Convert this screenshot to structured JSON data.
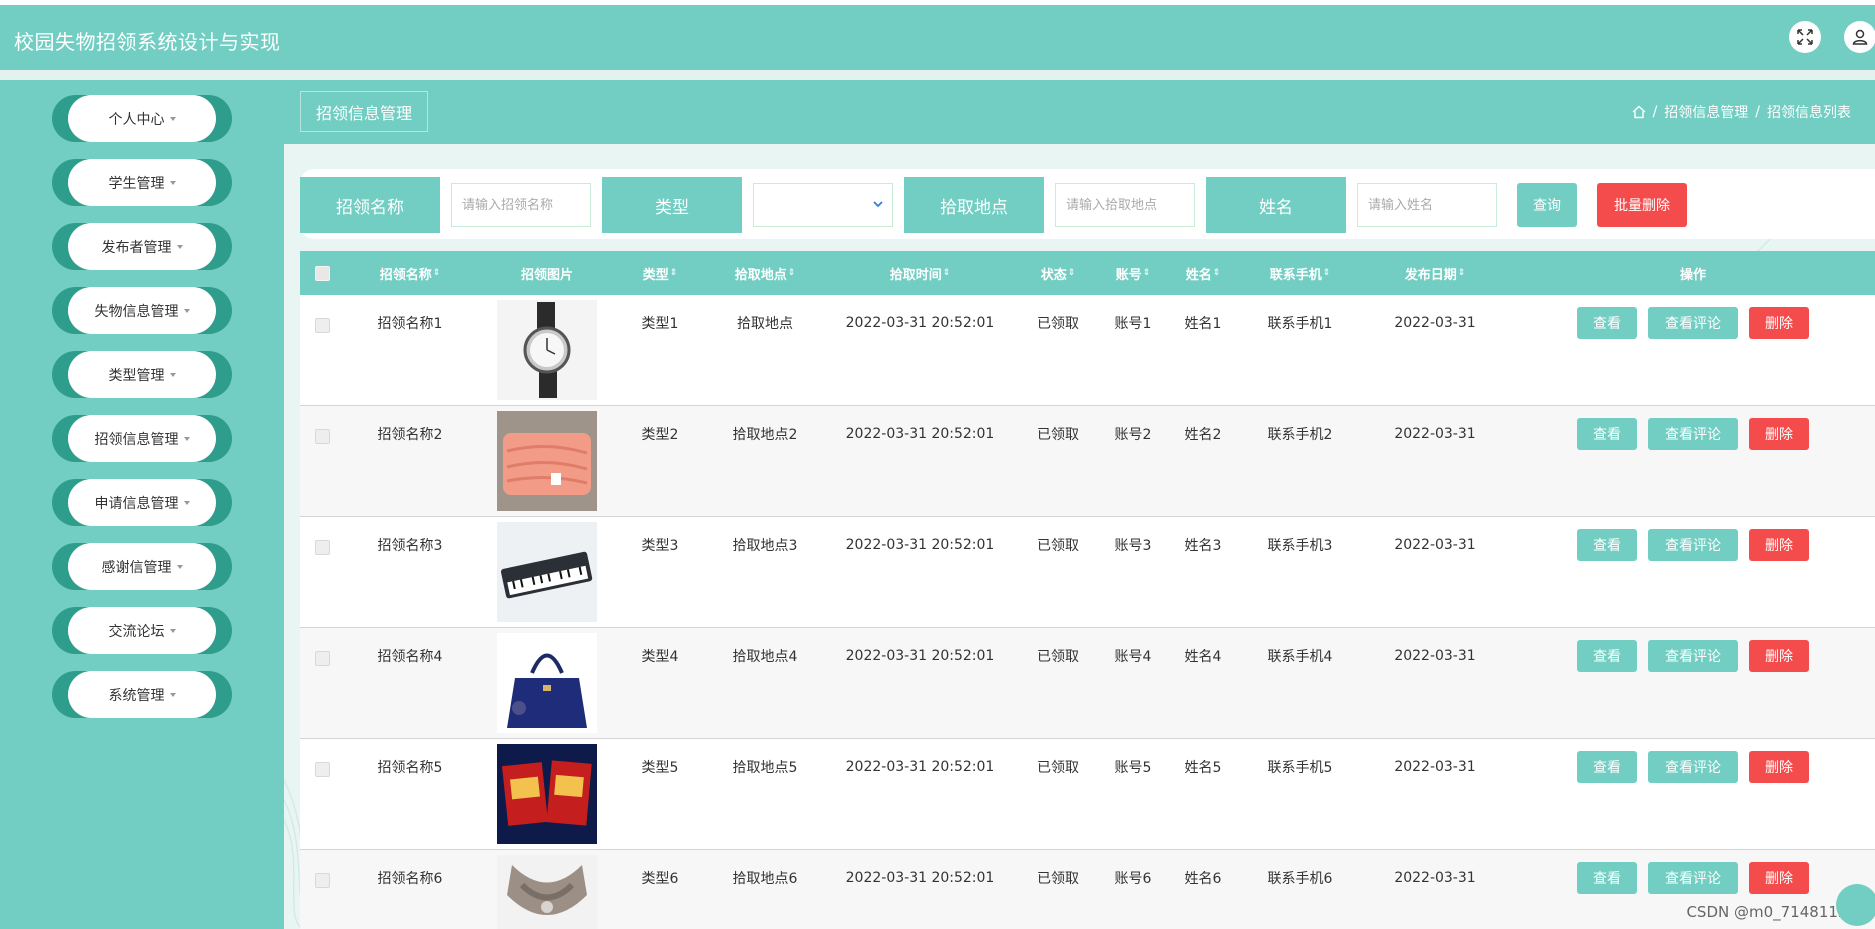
{
  "app": {
    "title": "校园失物招领系统设计与实现"
  },
  "header_icons": [
    "fullscreen-icon",
    "user-icon"
  ],
  "sidebar": {
    "items": [
      {
        "label": "个人中心"
      },
      {
        "label": "学生管理"
      },
      {
        "label": "发布者管理"
      },
      {
        "label": "失物信息管理"
      },
      {
        "label": "类型管理"
      },
      {
        "label": "招领信息管理"
      },
      {
        "label": "申请信息管理"
      },
      {
        "label": "感谢信管理"
      },
      {
        "label": "交流论坛"
      },
      {
        "label": "系统管理"
      }
    ]
  },
  "page": {
    "section_label": "招领信息管理",
    "breadcrumb": [
      "招领信息管理",
      "招领信息列表"
    ],
    "breadcrumb_sep": "/"
  },
  "search": {
    "name_label": "招领名称",
    "name_placeholder": "请输入招领名称",
    "type_label": "类型",
    "type_value": "",
    "place_label": "拾取地点",
    "place_placeholder": "请输入拾取地点",
    "person_label": "姓名",
    "person_placeholder": "请输入姓名",
    "query_button": "查询",
    "batch_delete_button": "批量删除"
  },
  "table": {
    "headers": {
      "name": "招领名称",
      "image": "招领图片",
      "type": "类型",
      "place": "拾取地点",
      "time": "拾取时间",
      "status": "状态",
      "account": "账号",
      "person": "姓名",
      "phone": "联系手机",
      "date": "发布日期",
      "ops": "操作"
    },
    "actions": {
      "view": "查看",
      "comments": "查看评论",
      "delete": "删除"
    },
    "rows": [
      {
        "name": "招领名称1",
        "image": "watch",
        "type": "类型1",
        "place": "拾取地点",
        "time": "2022-03-31 20:52:01",
        "status": "已领取",
        "account": "账号1",
        "person": "姓名1",
        "phone": "联系手机1",
        "date": "2022-03-31"
      },
      {
        "name": "招领名称2",
        "image": "blanket",
        "type": "类型2",
        "place": "拾取地点2",
        "time": "2022-03-31 20:52:01",
        "status": "已领取",
        "account": "账号2",
        "person": "姓名2",
        "phone": "联系手机2",
        "date": "2022-03-31"
      },
      {
        "name": "招领名称3",
        "image": "keyboard",
        "type": "类型3",
        "place": "拾取地点3",
        "time": "2022-03-31 20:52:01",
        "status": "已领取",
        "account": "账号3",
        "person": "姓名3",
        "phone": "联系手机3",
        "date": "2022-03-31"
      },
      {
        "name": "招领名称4",
        "image": "handbag",
        "type": "类型4",
        "place": "拾取地点4",
        "time": "2022-03-31 20:52:01",
        "status": "已领取",
        "account": "账号4",
        "person": "姓名4",
        "phone": "联系手机4",
        "date": "2022-03-31"
      },
      {
        "name": "招领名称5",
        "image": "snack-pack",
        "type": "类型5",
        "place": "拾取地点5",
        "time": "2022-03-31 20:52:01",
        "status": "已领取",
        "account": "账号5",
        "person": "姓名5",
        "phone": "联系手机5",
        "date": "2022-03-31"
      },
      {
        "name": "招领名称6",
        "image": "neck-massager",
        "type": "类型6",
        "place": "拾取地点6",
        "time": "2022-03-31 20:52:01",
        "status": "已领取",
        "account": "账号6",
        "person": "姓名6",
        "phone": "联系手机6",
        "date": "2022-03-31"
      }
    ]
  },
  "watermark": "CSDN @m0_71481126",
  "colors": {
    "primary": "#72cec3",
    "sidebar_pill_edge": "#2f9d8b",
    "danger": "#f44c4c",
    "main_bg": "#e8f5f2"
  }
}
